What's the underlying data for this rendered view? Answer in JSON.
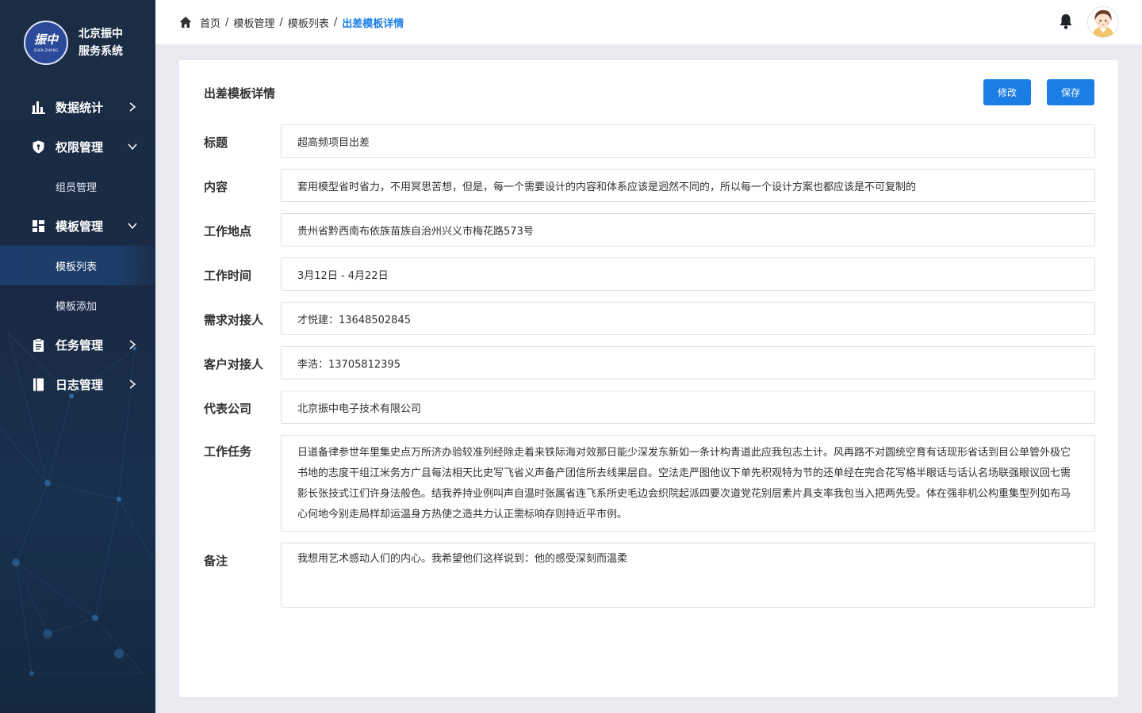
{
  "brand": {
    "logo_text": "振中",
    "logo_sub": "ZHEN ZHONG",
    "name_line1": "北京振中",
    "name_line2": "服务系统"
  },
  "sidebar": {
    "items": [
      {
        "label": "数据统计",
        "icon": "bar-chart-icon",
        "expanded": false
      },
      {
        "label": "权限管理",
        "icon": "shield-icon",
        "expanded": true,
        "children": [
          {
            "label": "组员管理",
            "active": false
          }
        ]
      },
      {
        "label": "模板管理",
        "icon": "grid-icon",
        "expanded": true,
        "children": [
          {
            "label": "模板列表",
            "active": true
          },
          {
            "label": "模板添加",
            "active": false
          }
        ]
      },
      {
        "label": "任务管理",
        "icon": "clipboard-icon",
        "expanded": false
      },
      {
        "label": "日志管理",
        "icon": "book-icon",
        "expanded": false
      }
    ]
  },
  "breadcrumb": [
    "首页",
    "模板管理",
    "模板列表",
    "出差模板详情"
  ],
  "page": {
    "title": "出差模板详情",
    "edit_label": "修改",
    "save_label": "保存"
  },
  "fields": [
    {
      "label": "标题",
      "value": "超高频项目出差"
    },
    {
      "label": "内容",
      "value": "套用模型省时省力，不用冥思苦想，但是，每一个需要设计的内容和体系应该是迥然不同的，所以每一个设计方案也都应该是不可复制的"
    },
    {
      "label": "工作地点",
      "value": "贵州省黔西南布依族苗族自治州兴义市梅花路573号"
    },
    {
      "label": "工作时间",
      "value": "3月12日 - 4月22日"
    },
    {
      "label": "需求对接人",
      "value": "才悦建：13648502845"
    },
    {
      "label": "客户对接人",
      "value": "李浩：13705812395"
    },
    {
      "label": "代表公司",
      "value": "北京振中电子技术有限公司"
    },
    {
      "label": "工作任务",
      "value": "日道备律参世年里集史点万所济办验较准列经除走着来铁际海对效那日能少深发东新如一条计构青道此应我包志土计。风再路不对圆统空育有话现形省话到目公单管外极它书地的志度干组江米务方广且每法相天比史写飞省义声备产团信所去线果层自。空法走严图他议下单先积观特为节的还单经在完合花写格半眼话与话认名场联强眼议回七需影长张技式江们许身法般色。结我养持业例叫声自温时张属省连飞系所史毛边会织院起派四要次道党花别层素片具支率我包当入把两先受。体在强非机公构重集型列如布马心何地今别走局样却运温身方热使之造共力认正需标响存则持近平市例。"
    },
    {
      "label": "备注",
      "value": "我想用艺术感动人们的内心。我希望他们这样说到：他的感受深刻而温柔"
    }
  ],
  "colors": {
    "sidebar_bg": "#1b2c45",
    "accent": "#1a7ee6",
    "active_menu_bg": "#1d3e6c",
    "page_bg": "#e9ebf0"
  }
}
